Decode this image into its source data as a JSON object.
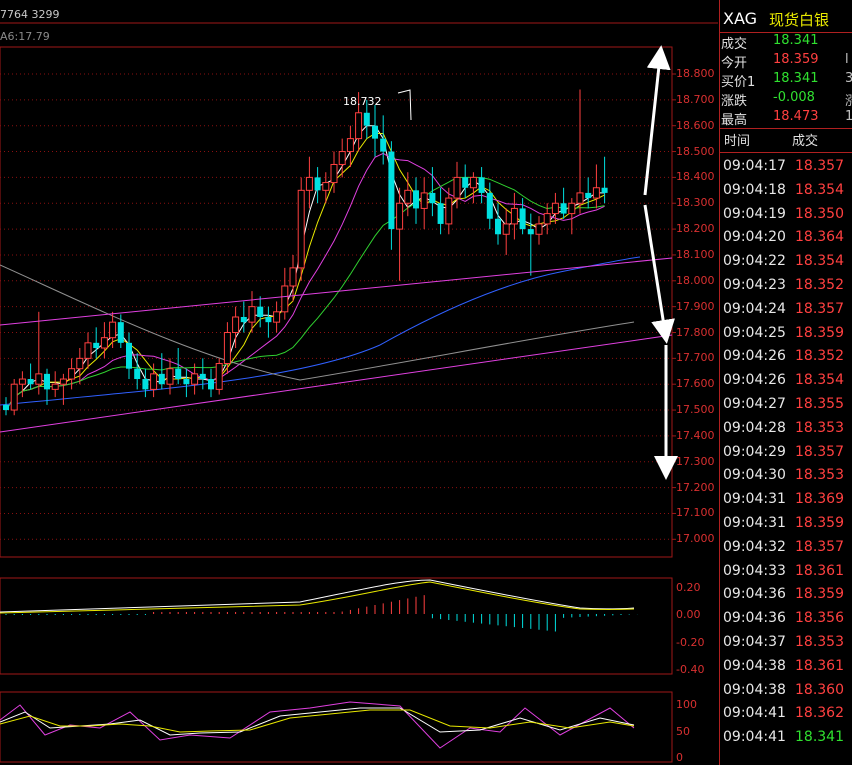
{
  "header": {
    "info_line": "7764  3299",
    "ma_line": "A6:17.79",
    "peak_label": "18.732"
  },
  "main_axis": {
    "labels": [
      "18.800",
      "18.700",
      "18.600",
      "18.500",
      "18.400",
      "18.300",
      "18.200",
      "18.100",
      "18.000",
      "17.900",
      "17.800",
      "17.700",
      "17.600",
      "17.500",
      "17.400",
      "17.300",
      "17.200",
      "17.100",
      "17.000"
    ]
  },
  "macd_axis": {
    "labels": [
      "0.20",
      "0.00",
      "-0.20",
      "-0.40"
    ]
  },
  "kdj_axis": {
    "labels": [
      "100",
      "50",
      "0"
    ]
  },
  "colors": {
    "up_candle": "#ff4040",
    "down_candle": "#00e0e0",
    "grid": "#8a1010",
    "ma5": "#ffffff",
    "ma10": "#e8e800",
    "ma20": "#e040e0",
    "ma30": "#30d030",
    "ma60": "#3060ff",
    "ma120": "#909090",
    "channel": "#e040e0",
    "arrows": "#ffffff"
  },
  "quote": {
    "symbol": "XAG",
    "name": "现货白银",
    "rows": [
      {
        "label": "成交",
        "value": "18.341",
        "trend": "green",
        "cut": ""
      },
      {
        "label": "今开",
        "value": "18.359",
        "trend": "red",
        "cut": "l"
      },
      {
        "label": "买价1",
        "value": "18.341",
        "trend": "green",
        "cut": "3"
      },
      {
        "label": "涨跌",
        "value": "-0.008",
        "trend": "green",
        "cut": "涨"
      },
      {
        "label": "最高",
        "value": "18.473",
        "trend": "red",
        "cut": "1"
      }
    ]
  },
  "ticks": {
    "header_time": "时间",
    "header_price": "成交",
    "rows": [
      {
        "time": "09:04:17",
        "price": "18.357",
        "trend": "up"
      },
      {
        "time": "09:04:18",
        "price": "18.354",
        "trend": "up"
      },
      {
        "time": "09:04:19",
        "price": "18.350",
        "trend": "up"
      },
      {
        "time": "09:04:20",
        "price": "18.364",
        "trend": "up"
      },
      {
        "time": "09:04:22",
        "price": "18.354",
        "trend": "up"
      },
      {
        "time": "09:04:23",
        "price": "18.352",
        "trend": "up"
      },
      {
        "time": "09:04:24",
        "price": "18.357",
        "trend": "up"
      },
      {
        "time": "09:04:25",
        "price": "18.359",
        "trend": "up"
      },
      {
        "time": "09:04:26",
        "price": "18.352",
        "trend": "up"
      },
      {
        "time": "09:04:26",
        "price": "18.354",
        "trend": "up"
      },
      {
        "time": "09:04:27",
        "price": "18.355",
        "trend": "up"
      },
      {
        "time": "09:04:28",
        "price": "18.353",
        "trend": "up"
      },
      {
        "time": "09:04:29",
        "price": "18.357",
        "trend": "up"
      },
      {
        "time": "09:04:30",
        "price": "18.353",
        "trend": "up"
      },
      {
        "time": "09:04:31",
        "price": "18.369",
        "trend": "up"
      },
      {
        "time": "09:04:31",
        "price": "18.359",
        "trend": "up"
      },
      {
        "time": "09:04:32",
        "price": "18.357",
        "trend": "up"
      },
      {
        "time": "09:04:33",
        "price": "18.361",
        "trend": "up"
      },
      {
        "time": "09:04:36",
        "price": "18.359",
        "trend": "up"
      },
      {
        "time": "09:04:36",
        "price": "18.356",
        "trend": "up"
      },
      {
        "time": "09:04:37",
        "price": "18.353",
        "trend": "up"
      },
      {
        "time": "09:04:38",
        "price": "18.361",
        "trend": "up"
      },
      {
        "time": "09:04:38",
        "price": "18.360",
        "trend": "up"
      },
      {
        "time": "09:04:41",
        "price": "18.362",
        "trend": "up"
      },
      {
        "time": "09:04:41",
        "price": "18.341",
        "trend": "down"
      }
    ]
  },
  "chart_data": {
    "type": "candlestick",
    "series_candles": [
      [
        17.52,
        17.55,
        17.48,
        17.5
      ],
      [
        17.5,
        17.62,
        17.48,
        17.6
      ],
      [
        17.6,
        17.65,
        17.55,
        17.62
      ],
      [
        17.62,
        17.68,
        17.58,
        17.6
      ],
      [
        17.6,
        17.88,
        17.56,
        17.64
      ],
      [
        17.64,
        17.66,
        17.52,
        17.58
      ],
      [
        17.58,
        17.65,
        17.55,
        17.6
      ],
      [
        17.6,
        17.64,
        17.52,
        17.62
      ],
      [
        17.62,
        17.7,
        17.58,
        17.66
      ],
      [
        17.66,
        17.74,
        17.6,
        17.7
      ],
      [
        17.7,
        17.8,
        17.66,
        17.76
      ],
      [
        17.76,
        17.82,
        17.7,
        17.74
      ],
      [
        17.74,
        17.84,
        17.7,
        17.78
      ],
      [
        17.78,
        17.88,
        17.74,
        17.84
      ],
      [
        17.84,
        17.87,
        17.74,
        17.76
      ],
      [
        17.76,
        17.8,
        17.62,
        17.66
      ],
      [
        17.66,
        17.72,
        17.58,
        17.62
      ],
      [
        17.62,
        17.66,
        17.55,
        17.58
      ],
      [
        17.58,
        17.68,
        17.55,
        17.64
      ],
      [
        17.64,
        17.72,
        17.58,
        17.6
      ],
      [
        17.6,
        17.7,
        17.56,
        17.66
      ],
      [
        17.66,
        17.74,
        17.6,
        17.62
      ],
      [
        17.62,
        17.66,
        17.55,
        17.6
      ],
      [
        17.6,
        17.68,
        17.56,
        17.64
      ],
      [
        17.64,
        17.7,
        17.58,
        17.62
      ],
      [
        17.62,
        17.66,
        17.55,
        17.58
      ],
      [
        17.58,
        17.7,
        17.56,
        17.68
      ],
      [
        17.68,
        17.84,
        17.64,
        17.8
      ],
      [
        17.8,
        17.9,
        17.74,
        17.86
      ],
      [
        17.86,
        17.92,
        17.8,
        17.84
      ],
      [
        17.84,
        17.96,
        17.8,
        17.9
      ],
      [
        17.9,
        17.94,
        17.82,
        17.86
      ],
      [
        17.86,
        17.9,
        17.78,
        17.84
      ],
      [
        17.84,
        17.92,
        17.8,
        17.88
      ],
      [
        17.88,
        18.05,
        17.85,
        17.98
      ],
      [
        17.98,
        18.1,
        17.92,
        18.05
      ],
      [
        18.05,
        18.4,
        18.0,
        18.35
      ],
      [
        18.35,
        18.48,
        18.28,
        18.4
      ],
      [
        18.4,
        18.44,
        18.3,
        18.35
      ],
      [
        18.35,
        18.42,
        18.3,
        18.38
      ],
      [
        18.38,
        18.5,
        18.34,
        18.45
      ],
      [
        18.45,
        18.55,
        18.4,
        18.5
      ],
      [
        18.5,
        18.6,
        18.44,
        18.55
      ],
      [
        18.55,
        18.73,
        18.5,
        18.65
      ],
      [
        18.65,
        18.7,
        18.55,
        18.6
      ],
      [
        18.6,
        18.68,
        18.48,
        18.55
      ],
      [
        18.55,
        18.64,
        18.45,
        18.5
      ],
      [
        18.5,
        18.54,
        18.12,
        18.2
      ],
      [
        18.2,
        18.36,
        18.0,
        18.3
      ],
      [
        18.3,
        18.42,
        18.25,
        18.35
      ],
      [
        18.35,
        18.4,
        18.22,
        18.28
      ],
      [
        18.28,
        18.4,
        18.2,
        18.34
      ],
      [
        18.34,
        18.44,
        18.25,
        18.3
      ],
      [
        18.3,
        18.36,
        18.18,
        18.22
      ],
      [
        18.22,
        18.36,
        18.18,
        18.32
      ],
      [
        18.32,
        18.46,
        18.28,
        18.4
      ],
      [
        18.4,
        18.45,
        18.32,
        18.36
      ],
      [
        18.36,
        18.42,
        18.3,
        18.4
      ],
      [
        18.4,
        18.44,
        18.3,
        18.34
      ],
      [
        18.34,
        18.38,
        18.2,
        18.24
      ],
      [
        18.24,
        18.3,
        18.14,
        18.18
      ],
      [
        18.18,
        18.28,
        18.1,
        18.22
      ],
      [
        18.22,
        18.34,
        18.16,
        18.28
      ],
      [
        18.28,
        18.32,
        18.18,
        18.2
      ],
      [
        18.2,
        18.26,
        18.02,
        18.18
      ],
      [
        18.18,
        18.25,
        18.14,
        18.22
      ],
      [
        18.22,
        18.3,
        18.18,
        18.26
      ],
      [
        18.26,
        18.34,
        18.22,
        18.3
      ],
      [
        18.3,
        18.36,
        18.24,
        18.26
      ],
      [
        18.26,
        18.32,
        18.18,
        18.3
      ],
      [
        18.3,
        18.74,
        18.26,
        18.34
      ],
      [
        18.34,
        18.4,
        18.28,
        18.32
      ],
      [
        18.32,
        18.45,
        18.28,
        18.36
      ],
      [
        18.36,
        18.48,
        18.3,
        18.34
      ]
    ],
    "ylim": [
      17.0,
      18.85
    ]
  }
}
